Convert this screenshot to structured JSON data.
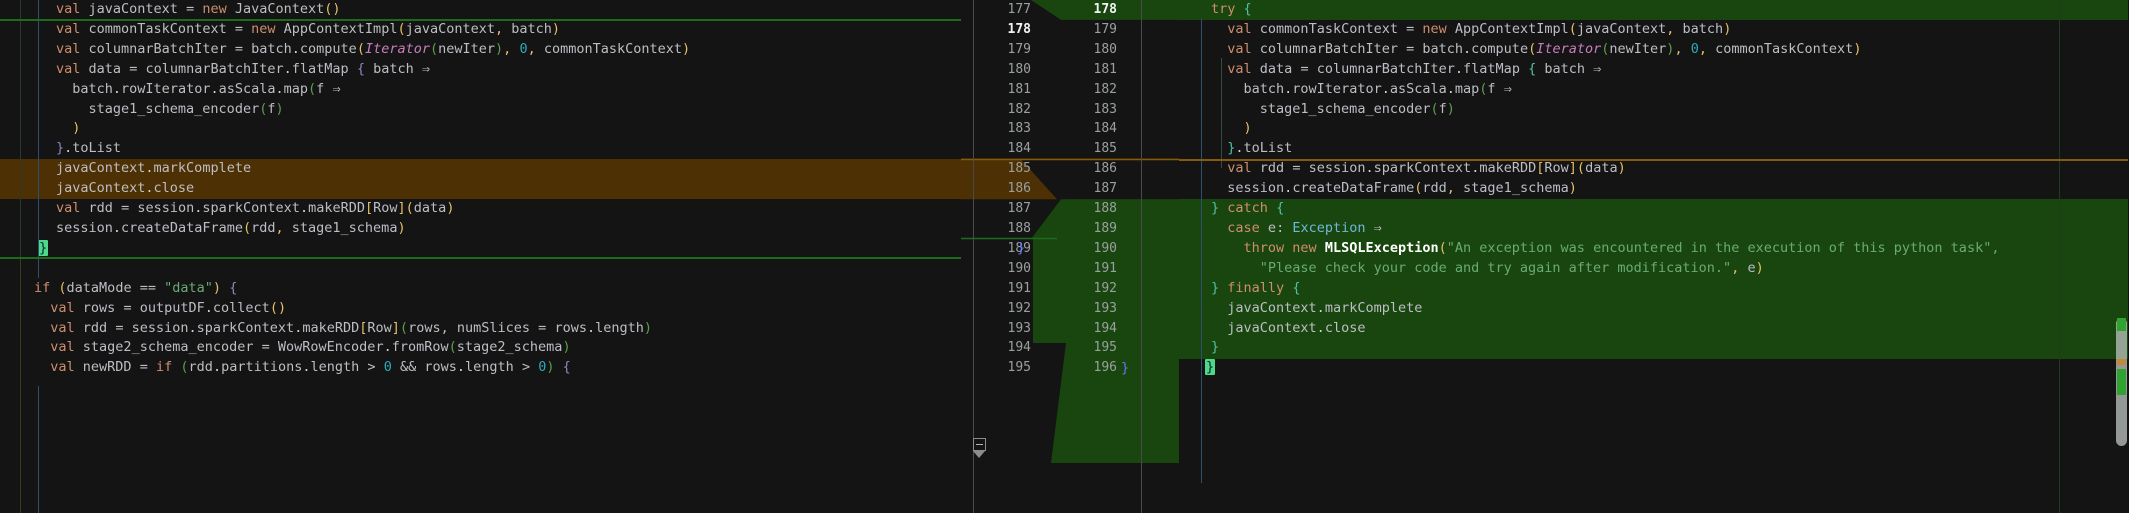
{
  "app": {
    "kind": "side-by-side-diff-viewer",
    "theme": "dark",
    "language": "Scala"
  },
  "colors": {
    "editor_background": "#141414",
    "deleted_background": "#4d3003",
    "added_background": "#19450f",
    "insert_marker": "#1d6b1d",
    "delete_marker": "#8a5a0b",
    "gutter_text": "#9aa0a0",
    "current_line_number": "#f2f2f2",
    "brace_match_highlight": "#4cd98a",
    "scrollbar_thumb": "#b9bebb"
  },
  "left_pane": {
    "name": "before-version",
    "lines": [
      {
        "text": "val javaContext = new JavaContext()",
        "state": "normal"
      },
      {
        "text": "val commonTaskContext = new AppContextImpl(javaContext, batch)",
        "state": "normal"
      },
      {
        "text": "val columnarBatchIter = batch.compute(Iterator(newIter), 0, commonTaskContext)",
        "state": "normal"
      },
      {
        "text": "val data = columnarBatchIter.flatMap { batch ⇒",
        "state": "normal"
      },
      {
        "text": "  batch.rowIterator.asScala.map(f ⇒",
        "state": "normal"
      },
      {
        "text": "    stage1_schema_encoder(f)",
        "state": "normal"
      },
      {
        "text": "  )",
        "state": "normal"
      },
      {
        "text": "}.toList",
        "state": "normal"
      },
      {
        "text": "javaContext.markComplete",
        "state": "deleted"
      },
      {
        "text": "javaContext.close",
        "state": "deleted"
      },
      {
        "text": "val rdd = session.sparkContext.makeRDD[Row](data)",
        "state": "normal"
      },
      {
        "text": "session.createDataFrame(rdd, stage1_schema)",
        "state": "normal"
      },
      {
        "text": "}",
        "state": "normal"
      },
      {
        "text": "",
        "state": "normal"
      },
      {
        "text": "if (dataMode == \"data\") {",
        "state": "normal"
      },
      {
        "text": "  val rows = outputDF.collect()",
        "state": "normal"
      },
      {
        "text": "  val rdd = session.sparkContext.makeRDD[Row](rows, numSlices = rows.length)",
        "state": "normal"
      },
      {
        "text": "  val stage2_schema_encoder = WowRowEncoder.fromRow(stage2_schema)",
        "state": "normal"
      },
      {
        "text": "  val newRDD = if (rdd.partitions.length > 0 && rows.length > 0) {",
        "state": "normal"
      }
    ]
  },
  "right_pane": {
    "name": "after-version",
    "lines": [
      {
        "text": "try {",
        "state": "added"
      },
      {
        "text": "  val commonTaskContext = new AppContextImpl(javaContext, batch)",
        "state": "normal"
      },
      {
        "text": "  val columnarBatchIter = batch.compute(Iterator(newIter), 0, commonTaskContext)",
        "state": "normal"
      },
      {
        "text": "  val data = columnarBatchIter.flatMap { batch ⇒",
        "state": "normal"
      },
      {
        "text": "    batch.rowIterator.asScala.map(f ⇒",
        "state": "normal"
      },
      {
        "text": "      stage1_schema_encoder(f)",
        "state": "normal"
      },
      {
        "text": "    )",
        "state": "normal"
      },
      {
        "text": "  }.toList",
        "state": "normal"
      },
      {
        "text": "  val rdd = session.sparkContext.makeRDD[Row](data)",
        "state": "normal"
      },
      {
        "text": "  session.createDataFrame(rdd, stage1_schema)",
        "state": "normal"
      },
      {
        "text": "} catch {",
        "state": "added"
      },
      {
        "text": "  case e: Exception ⇒",
        "state": "added"
      },
      {
        "text": "    throw new MLSQLException(\"An exception was encountered in the execution of this python task\", ",
        "state": "added"
      },
      {
        "text": "      \"Please check your code and try again after modification.\", e)",
        "state": "added"
      },
      {
        "text": "} finally {",
        "state": "added"
      },
      {
        "text": "  javaContext.markComplete",
        "state": "added"
      },
      {
        "text": "  javaContext.close",
        "state": "added"
      },
      {
        "text": "}",
        "state": "added"
      },
      {
        "text": "}",
        "state": "normal"
      }
    ]
  },
  "gutter": {
    "name": "line-number-gutter",
    "left_numbers": [
      "177",
      "178",
      "179",
      "180",
      "181",
      "182",
      "183",
      "184",
      "185",
      "186",
      "187",
      "188",
      "189",
      "190",
      "191",
      "192",
      "193",
      "194",
      "195"
    ],
    "right_numbers": [
      "178",
      "179",
      "180",
      "181",
      "182",
      "183",
      "184",
      "185",
      "186",
      "187",
      "188",
      "189",
      "190",
      "191",
      "192",
      "193",
      "194",
      "195",
      "196"
    ],
    "left_current": "178",
    "right_current": "178",
    "fold_icon": "code-fold-collapse-icon",
    "fold_icon_row": 16
  },
  "scrollbar": {
    "name": "vertical-scrollbar",
    "thumb_top_pct": 62,
    "thumb_height_pct": 25,
    "markers": [
      {
        "color": "#2fa32f",
        "top_pct": 62,
        "height_pct": 2.5
      },
      {
        "color": "#c08a3a",
        "top_pct": 70,
        "height_pct": 1.2
      },
      {
        "color": "#2fa32f",
        "top_pct": 72,
        "height_pct": 5
      }
    ]
  }
}
